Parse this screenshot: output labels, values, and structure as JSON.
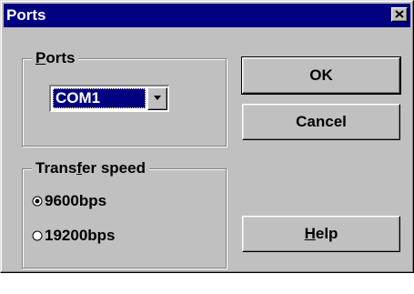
{
  "window": {
    "title": "Ports"
  },
  "ports_group": {
    "label_underline": "P",
    "label_rest": "orts",
    "selected_port": "COM1"
  },
  "speed_group": {
    "label_before": "Trans",
    "label_underline": "f",
    "label_after": "er speed",
    "options": [
      {
        "label": "9600bps",
        "selected": true
      },
      {
        "label": "19200bps",
        "selected": false
      }
    ]
  },
  "buttons": {
    "ok": "OK",
    "cancel": "Cancel",
    "help_underline": "H",
    "help_rest": "elp"
  },
  "icons": {
    "close": "close-icon",
    "dropdown": "chevron-down-icon",
    "radio": "radio-icon"
  },
  "colors": {
    "titlebar": "#000080",
    "face": "#c0c0c0",
    "selection": "#000080"
  }
}
